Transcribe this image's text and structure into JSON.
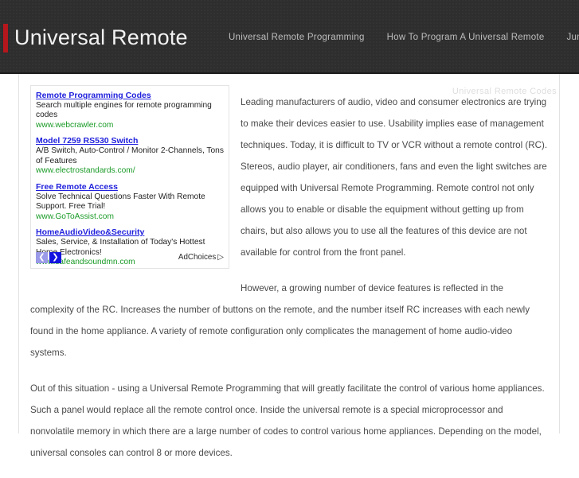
{
  "header": {
    "brand_title": "Universal Remote",
    "accent_color": "#b5171d",
    "background_color": "#2e2e2e",
    "nav": [
      {
        "label": "Universal Remote Programming"
      },
      {
        "label": "How To Program A Universal Remote"
      },
      {
        "label": "Jumbo"
      }
    ]
  },
  "page": {
    "label": "Universal Remote Codes"
  },
  "ads": {
    "units": [
      {
        "title": "Remote Programming Codes",
        "desc": "Search multiple engines for remote programming codes",
        "url": "www.webcrawler.com"
      },
      {
        "title": "Model 7259 RS530 Switch",
        "desc": "A/B Switch, Auto-Control / Monitor 2-Channels, Tons of Features",
        "url": "www.electrostandards.com/"
      },
      {
        "title": "Free Remote Access",
        "desc": "Solve Technical Questions Faster With Remote Support. Free Trial!",
        "url": "www.GoToAssist.com"
      },
      {
        "title": "HomeAudioVideo&Security",
        "desc": "Sales, Service, & Installation of Today's Hottest Home Electronics!",
        "url": "www.safeandsoundmn.com"
      }
    ],
    "pager": {
      "prev_label": "❮",
      "next_label": "❯",
      "prev_color": "#9a9ae8",
      "next_color": "#1414e0"
    },
    "adchoices_label": "AdChoices",
    "adchoices_glyph": "▷"
  },
  "article": {
    "paragraphs": [
      "Leading manufacturers of audio, video and consumer electronics are trying to make their devices easier to use. Usability implies ease of management techniques. Today, it is difficult to TV or VCR without a remote control (RC). Stereos, audio player, air conditioners, fans and even the light switches are equipped with Universal Remote Programming. Remote control not only allows you to enable or disable the equipment without getting up from chairs, but also allows you to use all the features of this device are not available for control from the front panel.",
      "However, a growing number of device features is reflected in the complexity of the RC. Increases the number of buttons on the remote, and the number itself RC increases with each newly found in the home appliance. A variety of remote configuration only complicates the management of home audio-video systems.",
      "Out of this situation - using a Universal Remote Programming that will greatly facilitate the control of various home appliances. Such a panel would replace all the remote control once. Inside the universal remote is a special microprocessor and nonvolatile memory in which there are a large number of codes to control various home appliances. Depending on the model, universal consoles can control 8 or more devices."
    ]
  }
}
